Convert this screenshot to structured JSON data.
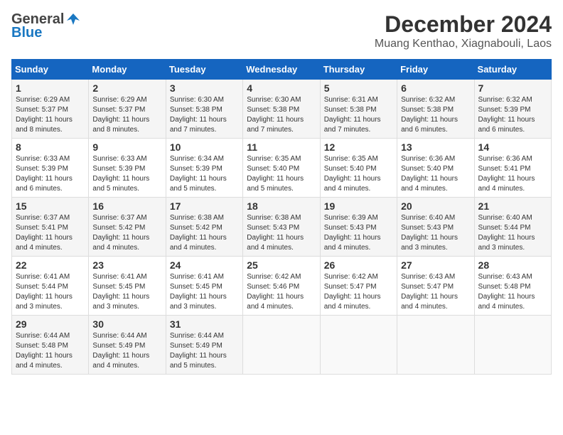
{
  "logo": {
    "general": "General",
    "blue": "Blue"
  },
  "header": {
    "month": "December 2024",
    "location": "Muang Kenthao, Xiagnabouli, Laos"
  },
  "weekdays": [
    "Sunday",
    "Monday",
    "Tuesday",
    "Wednesday",
    "Thursday",
    "Friday",
    "Saturday"
  ],
  "weeks": [
    [
      {
        "day": 1,
        "sunrise": "6:29 AM",
        "sunset": "5:37 PM",
        "daylight": "11 hours and 8 minutes."
      },
      {
        "day": 2,
        "sunrise": "6:29 AM",
        "sunset": "5:37 PM",
        "daylight": "11 hours and 8 minutes."
      },
      {
        "day": 3,
        "sunrise": "6:30 AM",
        "sunset": "5:38 PM",
        "daylight": "11 hours and 7 minutes."
      },
      {
        "day": 4,
        "sunrise": "6:30 AM",
        "sunset": "5:38 PM",
        "daylight": "11 hours and 7 minutes."
      },
      {
        "day": 5,
        "sunrise": "6:31 AM",
        "sunset": "5:38 PM",
        "daylight": "11 hours and 7 minutes."
      },
      {
        "day": 6,
        "sunrise": "6:32 AM",
        "sunset": "5:38 PM",
        "daylight": "11 hours and 6 minutes."
      },
      {
        "day": 7,
        "sunrise": "6:32 AM",
        "sunset": "5:39 PM",
        "daylight": "11 hours and 6 minutes."
      }
    ],
    [
      {
        "day": 8,
        "sunrise": "6:33 AM",
        "sunset": "5:39 PM",
        "daylight": "11 hours and 6 minutes."
      },
      {
        "day": 9,
        "sunrise": "6:33 AM",
        "sunset": "5:39 PM",
        "daylight": "11 hours and 5 minutes."
      },
      {
        "day": 10,
        "sunrise": "6:34 AM",
        "sunset": "5:39 PM",
        "daylight": "11 hours and 5 minutes."
      },
      {
        "day": 11,
        "sunrise": "6:35 AM",
        "sunset": "5:40 PM",
        "daylight": "11 hours and 5 minutes."
      },
      {
        "day": 12,
        "sunrise": "6:35 AM",
        "sunset": "5:40 PM",
        "daylight": "11 hours and 4 minutes."
      },
      {
        "day": 13,
        "sunrise": "6:36 AM",
        "sunset": "5:40 PM",
        "daylight": "11 hours and 4 minutes."
      },
      {
        "day": 14,
        "sunrise": "6:36 AM",
        "sunset": "5:41 PM",
        "daylight": "11 hours and 4 minutes."
      }
    ],
    [
      {
        "day": 15,
        "sunrise": "6:37 AM",
        "sunset": "5:41 PM",
        "daylight": "11 hours and 4 minutes."
      },
      {
        "day": 16,
        "sunrise": "6:37 AM",
        "sunset": "5:42 PM",
        "daylight": "11 hours and 4 minutes."
      },
      {
        "day": 17,
        "sunrise": "6:38 AM",
        "sunset": "5:42 PM",
        "daylight": "11 hours and 4 minutes."
      },
      {
        "day": 18,
        "sunrise": "6:38 AM",
        "sunset": "5:43 PM",
        "daylight": "11 hours and 4 minutes."
      },
      {
        "day": 19,
        "sunrise": "6:39 AM",
        "sunset": "5:43 PM",
        "daylight": "11 hours and 4 minutes."
      },
      {
        "day": 20,
        "sunrise": "6:40 AM",
        "sunset": "5:43 PM",
        "daylight": "11 hours and 3 minutes."
      },
      {
        "day": 21,
        "sunrise": "6:40 AM",
        "sunset": "5:44 PM",
        "daylight": "11 hours and 3 minutes."
      }
    ],
    [
      {
        "day": 22,
        "sunrise": "6:41 AM",
        "sunset": "5:44 PM",
        "daylight": "11 hours and 3 minutes."
      },
      {
        "day": 23,
        "sunrise": "6:41 AM",
        "sunset": "5:45 PM",
        "daylight": "11 hours and 3 minutes."
      },
      {
        "day": 24,
        "sunrise": "6:41 AM",
        "sunset": "5:45 PM",
        "daylight": "11 hours and 3 minutes."
      },
      {
        "day": 25,
        "sunrise": "6:42 AM",
        "sunset": "5:46 PM",
        "daylight": "11 hours and 4 minutes."
      },
      {
        "day": 26,
        "sunrise": "6:42 AM",
        "sunset": "5:47 PM",
        "daylight": "11 hours and 4 minutes."
      },
      {
        "day": 27,
        "sunrise": "6:43 AM",
        "sunset": "5:47 PM",
        "daylight": "11 hours and 4 minutes."
      },
      {
        "day": 28,
        "sunrise": "6:43 AM",
        "sunset": "5:48 PM",
        "daylight": "11 hours and 4 minutes."
      }
    ],
    [
      {
        "day": 29,
        "sunrise": "6:44 AM",
        "sunset": "5:48 PM",
        "daylight": "11 hours and 4 minutes."
      },
      {
        "day": 30,
        "sunrise": "6:44 AM",
        "sunset": "5:49 PM",
        "daylight": "11 hours and 4 minutes."
      },
      {
        "day": 31,
        "sunrise": "6:44 AM",
        "sunset": "5:49 PM",
        "daylight": "11 hours and 5 minutes."
      },
      null,
      null,
      null,
      null
    ]
  ],
  "labels": {
    "sunrise_prefix": "Sunrise: ",
    "sunset_prefix": "Sunset: ",
    "daylight_prefix": "Daylight: "
  }
}
